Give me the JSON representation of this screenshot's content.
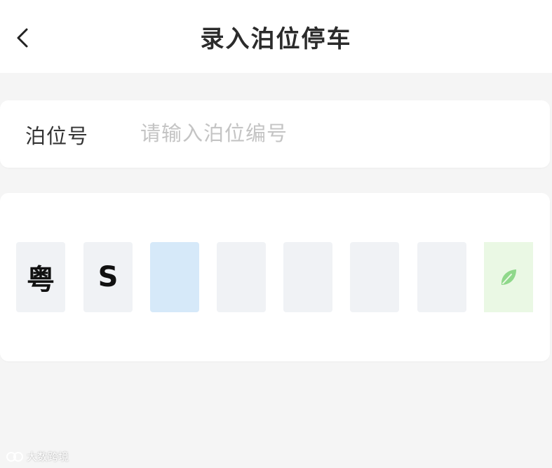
{
  "header": {
    "title": "录入泊位停车",
    "back_icon": "chevron-left-icon"
  },
  "berth": {
    "label": "泊位号",
    "placeholder": "请输入泊位编号",
    "value": ""
  },
  "plate": {
    "cells": [
      {
        "value": "粤",
        "state": "filled"
      },
      {
        "value": "S",
        "state": "filled"
      },
      {
        "value": "",
        "state": "active"
      },
      {
        "value": "",
        "state": "empty"
      },
      {
        "value": "",
        "state": "empty"
      },
      {
        "value": "",
        "state": "empty"
      },
      {
        "value": "",
        "state": "empty"
      },
      {
        "value": "",
        "state": "new-energy",
        "icon": "leaf-icon"
      }
    ]
  },
  "watermark": {
    "text": "大数跨境"
  },
  "colors": {
    "background": "#f5f5f5",
    "card": "#ffffff",
    "cell_empty": "#f0f2f5",
    "cell_active": "#d6e9f9",
    "cell_new_energy": "#eaf8e4",
    "leaf": "#8fd88a"
  }
}
